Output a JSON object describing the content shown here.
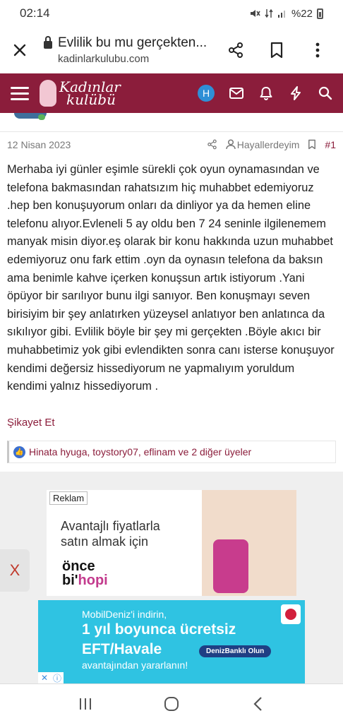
{
  "status_bar": {
    "time": "02:14",
    "battery": "%22"
  },
  "browser": {
    "page_title": "Evlilik bu mu gerçekten...",
    "domain": "kadinlarkulubu.com",
    "icons": [
      "close-icon",
      "lock-icon",
      "share-icon",
      "bookmark-icon",
      "more-vert-icon"
    ]
  },
  "site": {
    "logo_line1": "Kadınlar",
    "logo_line2": "kulübü",
    "avatar_initial": "H",
    "header_color": "#8b1d3b"
  },
  "post": {
    "date": "12 Nisan 2023",
    "author": "Hayallerdeyim",
    "number": "#1",
    "body": "Merhaba iyi günler eşimle sürekli çok oyun oynamasından ve telefona bakmasından rahatsızım hiç muhabbet edemiyoruz .hep ben konuşuyorum onları da dinliyor ya da hemen eline telefonu alıyor.Evleneli 5 ay oldu ben 7 24 seninle ilgilenemem manyak misin diyor.eş olarak bir konu hakkında uzun muhabbet edemiyoruz onu fark ettim .oyn da oynasın telefona da baksın ama benimle kahve içerken konuşsun artık istiyorum .Yani öpüyor bir sarılıyor bunu ilgi sanıyor. Ben konuşmayı seven birisiyim bir şey anlatırken yüzeysel anlatıyor ben anlatınca da sıkılıyor gibi. Evlilik böyle bir şey mi gerçekten .Böyle akıcı bir muhabbetimiz yok gibi evlendikten sonra canı isterse konuşuyor kendimi değersiz hissediyorum ne yapmalıyım yoruldum kendimi yalnız hissediyorum .",
    "report_label": "Şikayet Et",
    "likes_text": "Hinata hyuga, toystory07, eflinam ve 2 diğer üyeler"
  },
  "ad": {
    "label": "Reklam",
    "headline": "Avantajlı fiyatlarla satın almak için",
    "brand_line1": "önce",
    "brand_line2a": "bi'",
    "brand_line2b": "hopi"
  },
  "side_close": "X",
  "banner": {
    "line1": "MobilDeniz'i indirin,",
    "line2": "1 yıl boyunca ücretsiz",
    "line3": "EFT/Havale",
    "line4": "avantajından yararlanın!",
    "cta": "DenizBanklı Olun"
  }
}
